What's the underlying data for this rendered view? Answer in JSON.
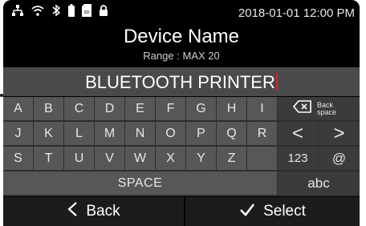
{
  "status": {
    "icons": [
      "network-icon",
      "wifi-icon",
      "bluetooth-icon",
      "battery-icon",
      "sd-card-icon",
      "lock-icon"
    ],
    "datetime": "2018-01-01 12:00 PM"
  },
  "header": {
    "title": "Device Name",
    "subtitle": "Range : MAX 20"
  },
  "entry": {
    "value": "BLUETOOTH PRINTER"
  },
  "keyboard": {
    "row1": [
      "A",
      "B",
      "C",
      "D",
      "E",
      "F",
      "G",
      "H",
      "I"
    ],
    "row2": [
      "J",
      "K",
      "L",
      "M",
      "N",
      "O",
      "P",
      "Q",
      "R"
    ],
    "row3": [
      "S",
      "T",
      "U",
      "V",
      "W",
      "X",
      "Y",
      "Z"
    ],
    "backspace_label": "Back space",
    "left_arrow": "<",
    "right_arrow": ">",
    "num_label": "123",
    "at_label": "@",
    "space_label": "SPACE",
    "mode_label": "abc"
  },
  "footer": {
    "back_label": "Back",
    "select_label": "Select"
  }
}
